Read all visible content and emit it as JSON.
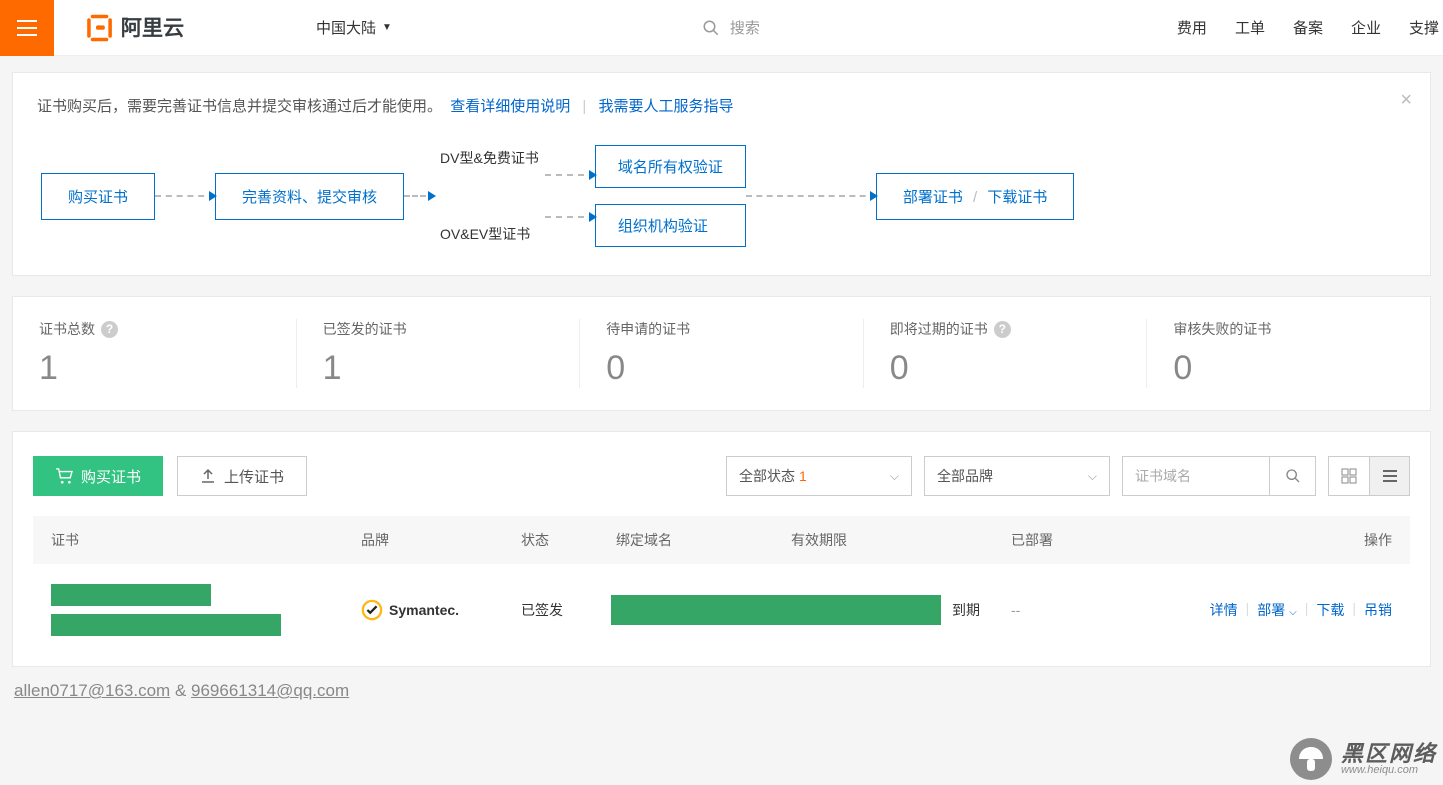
{
  "header": {
    "region": "中国大陆",
    "search_placeholder": "搜索",
    "nav": {
      "fee": "费用",
      "ticket": "工单",
      "beian": "备案",
      "enterprise": "企业",
      "support": "支撑"
    }
  },
  "notice": {
    "text_prefix": "证书购买后，需要完善证书信息并提交审核通过后才能使用。",
    "link_doc": "查看详细使用说明",
    "link_help": "我需要人工服务指导"
  },
  "flow": {
    "step1": "购买证书",
    "step2": "完善资料、提交审核",
    "label_dv": "DV型&免费证书",
    "label_ov": "OV&EV型证书",
    "step3a": "域名所有权验证",
    "step3b": "组织机构验证",
    "step4a": "部署证书",
    "step4b": "下载证书"
  },
  "stats": {
    "total": {
      "label": "证书总数",
      "value": "1"
    },
    "issued": {
      "label": "已签发的证书",
      "value": "1"
    },
    "pending": {
      "label": "待申请的证书",
      "value": "0"
    },
    "expiring": {
      "label": "即将过期的证书",
      "value": "0"
    },
    "failed": {
      "label": "审核失败的证书",
      "value": "0"
    }
  },
  "toolbar": {
    "buy": "购买证书",
    "upload": "上传证书",
    "status_select": "全部状态",
    "status_count": "1",
    "brand_select": "全部品牌",
    "domain_placeholder": "证书域名"
  },
  "table": {
    "headers": {
      "cert": "证书",
      "brand": "品牌",
      "status": "状态",
      "domain": "绑定域名",
      "expire": "有效期限",
      "deployed": "已部署",
      "action": "操作"
    },
    "row": {
      "brand": "Symantec.",
      "status": "已签发",
      "expire_suffix": "到期",
      "deployed": "--",
      "actions": {
        "detail": "详情",
        "deploy": "部署",
        "download": "下载",
        "revoke": "吊销"
      }
    }
  },
  "footer": {
    "email1": "allen0717@163.com",
    "amp": "&",
    "email2": "969661314@qq.com"
  },
  "watermark": {
    "cn": "黑区网络",
    "en": "www.heiqu.com"
  }
}
